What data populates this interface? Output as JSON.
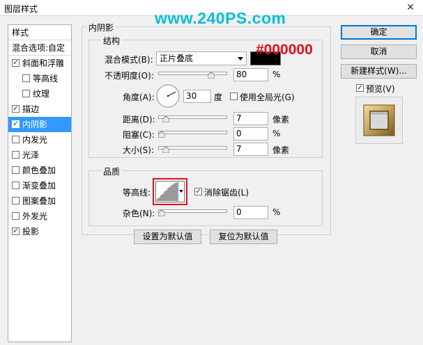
{
  "window": {
    "title": "图层样式",
    "close_glyph": "✕"
  },
  "watermark": "www.240PS.com",
  "sidebar": {
    "header_styles": "样式",
    "header_blending": "混合选项:自定",
    "items": [
      {
        "label": "斜面和浮雕",
        "checked": true,
        "indent": false,
        "selected": false
      },
      {
        "label": "等高线",
        "checked": false,
        "indent": true,
        "selected": false
      },
      {
        "label": "纹理",
        "checked": false,
        "indent": true,
        "selected": false
      },
      {
        "label": "描边",
        "checked": true,
        "indent": false,
        "selected": false
      },
      {
        "label": "内阴影",
        "checked": true,
        "indent": false,
        "selected": true
      },
      {
        "label": "内发光",
        "checked": false,
        "indent": false,
        "selected": false
      },
      {
        "label": "光泽",
        "checked": false,
        "indent": false,
        "selected": false
      },
      {
        "label": "颜色叠加",
        "checked": false,
        "indent": false,
        "selected": false
      },
      {
        "label": "渐变叠加",
        "checked": false,
        "indent": false,
        "selected": false
      },
      {
        "label": "图案叠加",
        "checked": false,
        "indent": false,
        "selected": false
      },
      {
        "label": "外发光",
        "checked": false,
        "indent": false,
        "selected": false
      },
      {
        "label": "投影",
        "checked": true,
        "indent": false,
        "selected": false
      }
    ],
    "check_glyph": "✓"
  },
  "panel": {
    "section_title": "内阴影",
    "structure": {
      "title": "结构",
      "blend_mode_label": "混合模式(B):",
      "blend_mode_value": "正片叠底",
      "color_hex": "#000000",
      "color_annotation": "#000000",
      "opacity_label": "不透明度(O):",
      "opacity_value": "80",
      "opacity_level": 0.8,
      "percent": "%",
      "angle_label": "角度(A):",
      "angle_value": "30",
      "angle_unit": "度",
      "global_light_label": "使用全局光(G)",
      "global_light_checked": false,
      "distance_label": "距离(D):",
      "distance_value": "7",
      "distance_unit": "像素",
      "distance_level": 0.07,
      "choke_label": "阻塞(C):",
      "choke_value": "0",
      "choke_level": 0.0,
      "size_label": "大小(S):",
      "size_value": "7",
      "size_unit": "像素",
      "size_level": 0.07
    },
    "quality": {
      "title": "品质",
      "contour_label": "等高线:",
      "antialias_label": "消除锯齿(L)",
      "antialias_checked": true,
      "noise_label": "杂色(N):",
      "noise_value": "0",
      "noise_level": 0.0
    },
    "make_default_button": "设置为默认值",
    "reset_default_button": "复位为默认值"
  },
  "actions": {
    "ok_button": "确定",
    "cancel_button": "取消",
    "new_style_button": "新建样式(W)...",
    "preview_label": "预览(V)",
    "preview_checked": true
  },
  "colors": {
    "selection": "#3399ff",
    "annotation_red": "#e0101b",
    "watermark": "#0abfd3",
    "frame_gold": "#c9a85e"
  }
}
